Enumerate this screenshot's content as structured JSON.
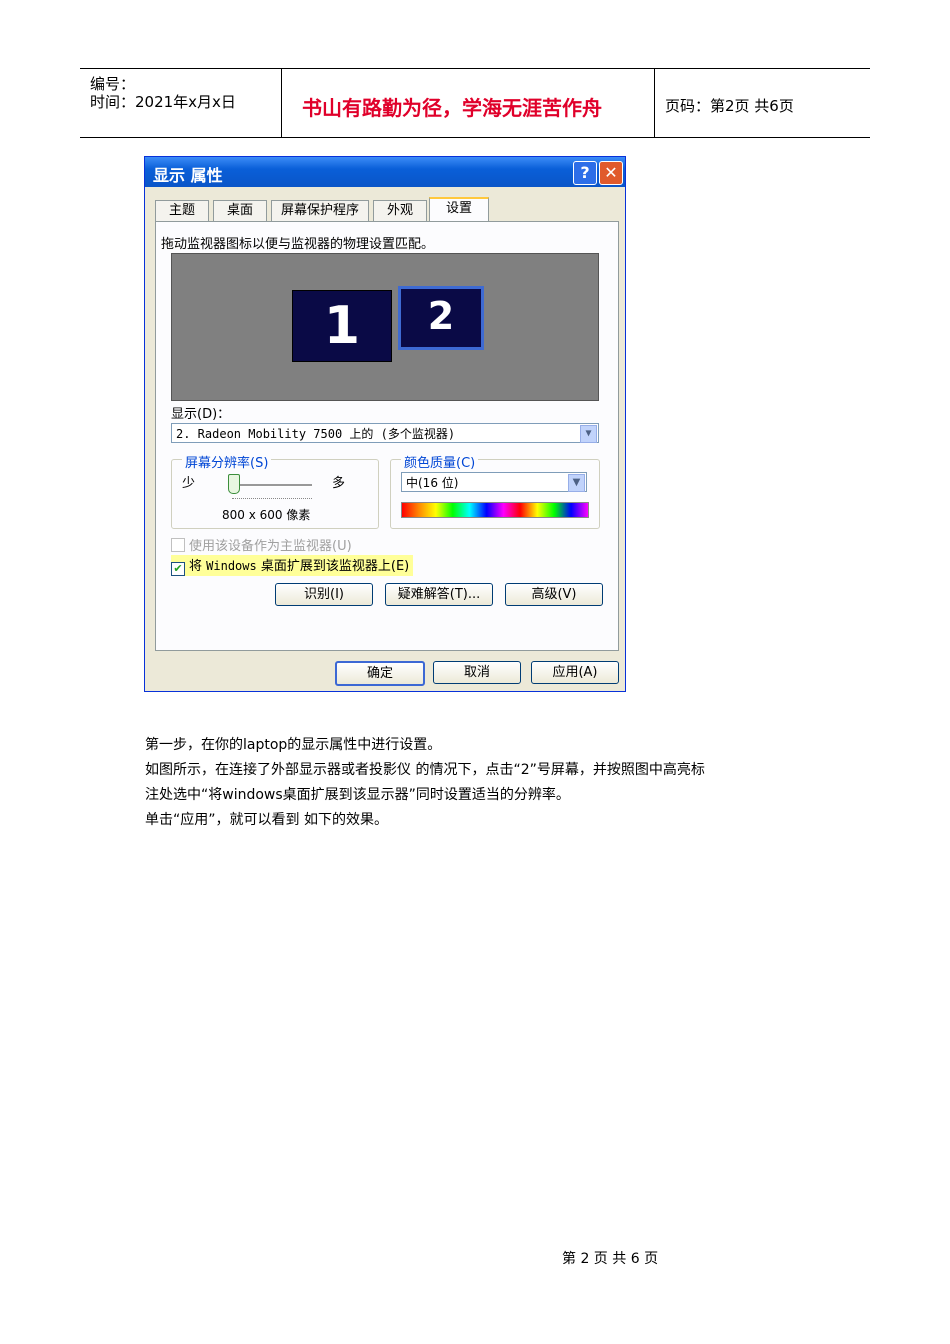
{
  "header": {
    "number_label": "编号：",
    "time_label": "时间：2021年x月x日",
    "motto": "书山有路勤为径，学海无涯苦作舟",
    "page_label": "页码：第2页 共6页"
  },
  "dialog": {
    "title": "显示 属性",
    "help": "?",
    "close": "✕",
    "tabs": [
      {
        "label": "主题"
      },
      {
        "label": "桌面"
      },
      {
        "label": "屏幕保护程序"
      },
      {
        "label": "外观"
      },
      {
        "label": "设置"
      }
    ],
    "active_tab": "设置",
    "instruction": "拖动监视器图标以便与监视器的物理设置匹配。",
    "monitors": [
      "1",
      "2"
    ],
    "display_label": "显示(D)：",
    "display_value": "2. Radeon Mobility 7500 上的 (多个监视器)",
    "resolution": {
      "legend": "屏幕分辨率(S)",
      "less": "少",
      "more": "多",
      "value": "800 x 600 像素"
    },
    "color_quality": {
      "legend": "颜色质量(C)",
      "value": "中(16 位)"
    },
    "primary_checkbox": "使用该设备作为主监视器(U)",
    "extend_checkbox_prefix": "将",
    "extend_checkbox_windows": "Windows",
    "extend_checkbox_suffix": "桌面扩展到该监视器上(E)",
    "buttons": {
      "identify": "识别(I)",
      "troubleshoot": "疑难解答(T)...",
      "advanced": "高级(V)",
      "ok": "确定",
      "cancel": "取消",
      "apply": "应用(A)"
    }
  },
  "body": {
    "para1": "第一步，在你的laptop的显示属性中进行设置。",
    "para2": "如图所示，在连接了外部显示器或者投影仪 的情况下，点击“2”号屏幕，并按照图中高亮标",
    "para3": "注处选中“将windows桌面扩展到该显示器”同时设置适当的分辨率。",
    "para4": "单击“应用”，就可以看到 如下的效果。"
  },
  "footer": "第 2 页 共 6 页"
}
